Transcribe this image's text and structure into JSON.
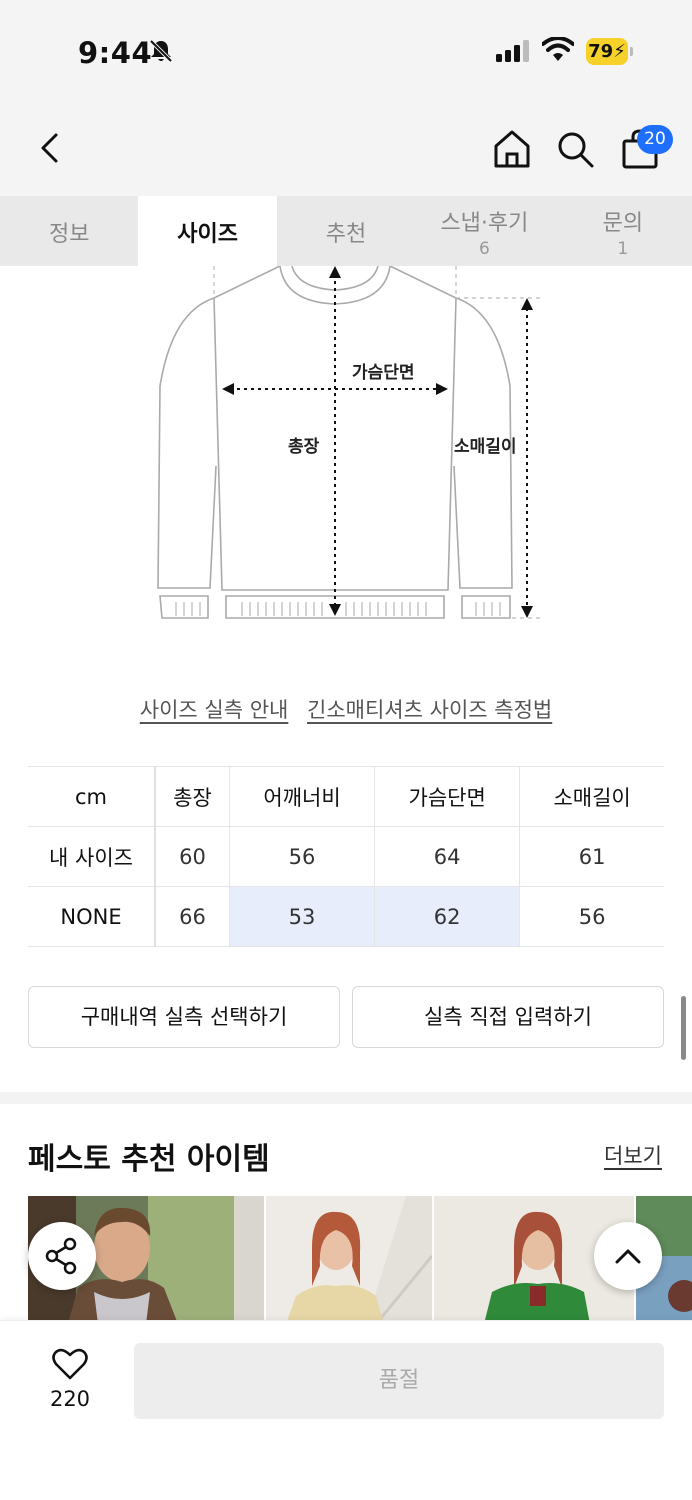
{
  "status_bar": {
    "time": "9:44",
    "battery": "79"
  },
  "header": {
    "cart_count": "20"
  },
  "tabs": [
    {
      "label": "정보",
      "count": ""
    },
    {
      "label": "사이즈",
      "count": ""
    },
    {
      "label": "추천",
      "count": ""
    },
    {
      "label": "스냅·후기",
      "count": "6"
    },
    {
      "label": "문의",
      "count": "1"
    }
  ],
  "diagram": {
    "chest": "가슴단면",
    "length": "총장",
    "sleeve": "소매길이"
  },
  "links": {
    "guide": "사이즈 실측 안내",
    "method": "긴소매티셔츠 사이즈 측정법"
  },
  "size_table": {
    "headers": [
      "cm",
      "총장",
      "어깨너비",
      "가슴단면",
      "소매길이"
    ],
    "rows": [
      [
        "내 사이즈",
        "60",
        "56",
        "64",
        "61"
      ],
      [
        "NONE",
        "66",
        "53",
        "62",
        "56"
      ]
    ]
  },
  "buttons": {
    "purchase_history": "구매내역 실측 선택하기",
    "direct_input": "실측 직접 입력하기"
  },
  "recommend": {
    "title": "페스토 추천 아이템",
    "more": "더보기"
  },
  "bottom_bar": {
    "likes": "220",
    "soldout": "품절"
  },
  "colors": {
    "accent": "#1f6fff",
    "highlight": "#e8edfb",
    "battery": "#f6d12a"
  }
}
